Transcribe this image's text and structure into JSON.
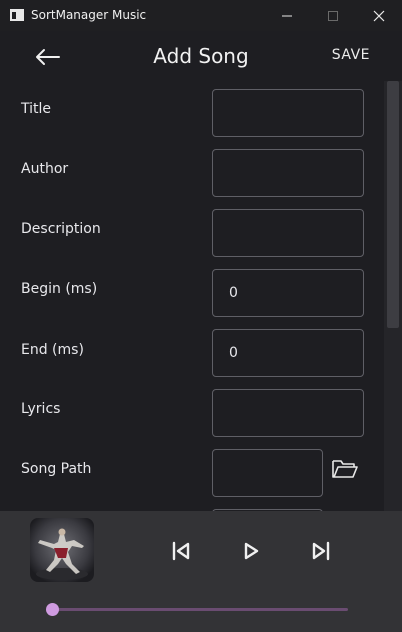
{
  "window": {
    "title": "SortManager Music"
  },
  "header": {
    "title": "Add Song",
    "save_label": "SAVE"
  },
  "form": {
    "fields": [
      {
        "label": "Title",
        "value": ""
      },
      {
        "label": "Author",
        "value": ""
      },
      {
        "label": "Description",
        "value": ""
      },
      {
        "label": "Begin (ms)",
        "value": "0"
      },
      {
        "label": "End (ms)",
        "value": "0"
      },
      {
        "label": "Lyrics",
        "value": ""
      },
      {
        "label": "Song Path",
        "value": ""
      }
    ]
  },
  "player": {
    "progress": 0.0
  },
  "icons": [
    "app-icon",
    "minimize-icon",
    "maximize-icon",
    "close-icon",
    "back-arrow-icon",
    "folder-icon",
    "skip-previous-icon",
    "play-icon",
    "skip-next-icon"
  ],
  "colors": {
    "background": "#1e1e22",
    "player_background": "#333336",
    "accent": "#cf9be0"
  }
}
